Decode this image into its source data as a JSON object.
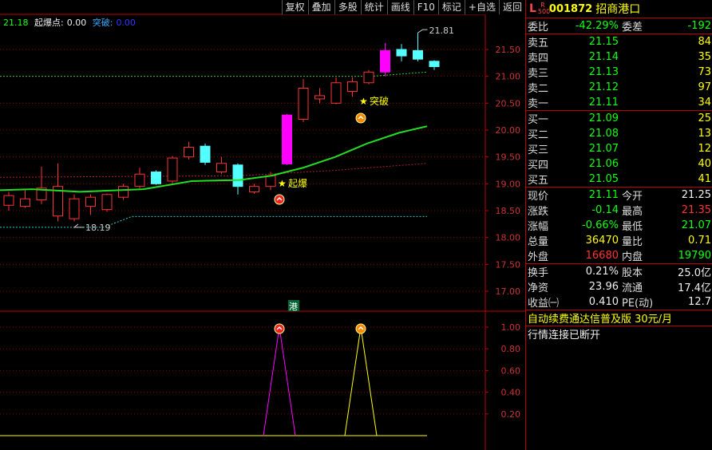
{
  "menu": [
    "复权",
    "叠加",
    "多股",
    "统计",
    "画线",
    "F10",
    "标记",
    "+自选",
    "返回"
  ],
  "indicator": {
    "price": "21.18",
    "qibao_label": "起爆点:",
    "qibao_value": "0.00",
    "tupo_label": "突破:",
    "tupo_value": "0.00"
  },
  "price_axis": [
    "21.50",
    "21.00",
    "20.50",
    "20.00",
    "19.50",
    "19.00",
    "18.50",
    "18.00",
    "17.50",
    "17.00"
  ],
  "sub_axis": [
    "1.00",
    "0.80",
    "0.60",
    "0.40",
    "0.20"
  ],
  "annotations": {
    "high": "21.81",
    "low": "18.19",
    "qibao": "起爆",
    "tupo": "突破",
    "gang": "港"
  },
  "candles": [
    {
      "o": 18.6,
      "c": 18.78,
      "h": 18.85,
      "l": 18.5
    },
    {
      "o": 18.58,
      "c": 18.72,
      "h": 18.88,
      "l": 18.55
    },
    {
      "o": 18.7,
      "c": 18.92,
      "h": 19.32,
      "l": 18.62
    },
    {
      "o": 18.4,
      "c": 18.95,
      "h": 19.38,
      "l": 18.3
    },
    {
      "o": 18.35,
      "c": 18.72,
      "h": 18.8,
      "l": 18.3
    },
    {
      "o": 18.58,
      "c": 18.75,
      "h": 18.8,
      "l": 18.42
    },
    {
      "o": 18.52,
      "c": 18.8,
      "h": 18.82,
      "l": 18.48
    },
    {
      "o": 18.75,
      "c": 18.95,
      "h": 19.0,
      "l": 18.7
    },
    {
      "o": 18.95,
      "c": 19.18,
      "h": 19.3,
      "l": 18.92
    },
    {
      "o": 19.22,
      "c": 19.0,
      "h": 19.25,
      "l": 18.98
    },
    {
      "o": 19.05,
      "c": 19.48,
      "h": 19.52,
      "l": 19.0
    },
    {
      "o": 19.5,
      "c": 19.68,
      "h": 19.78,
      "l": 19.45
    },
    {
      "o": 19.7,
      "c": 19.4,
      "h": 19.75,
      "l": 19.35
    },
    {
      "o": 19.22,
      "c": 19.38,
      "h": 19.5,
      "l": 19.18
    },
    {
      "o": 19.35,
      "c": 18.95,
      "h": 19.38,
      "l": 18.8
    },
    {
      "o": 18.85,
      "c": 18.95,
      "h": 19.0,
      "l": 18.82
    },
    {
      "o": 18.95,
      "c": 19.15,
      "h": 19.22,
      "l": 18.88
    },
    {
      "o": 19.37,
      "c": 20.28,
      "h": 20.3,
      "l": 19.35
    },
    {
      "o": 20.2,
      "c": 20.78,
      "h": 20.95,
      "l": 20.15
    },
    {
      "o": 20.58,
      "c": 20.64,
      "h": 20.78,
      "l": 20.5
    },
    {
      "o": 20.5,
      "c": 20.88,
      "h": 20.98,
      "l": 20.48
    },
    {
      "o": 20.72,
      "c": 20.9,
      "h": 20.98,
      "l": 20.62
    },
    {
      "o": 20.88,
      "c": 21.08,
      "h": 21.12,
      "l": 20.85
    },
    {
      "o": 21.08,
      "c": 21.48,
      "h": 21.62,
      "l": 21.0
    },
    {
      "o": 21.5,
      "c": 21.38,
      "h": 21.6,
      "l": 21.28
    },
    {
      "o": 21.48,
      "c": 21.32,
      "h": 21.81,
      "l": 21.28
    },
    {
      "o": 21.28,
      "c": 21.18,
      "h": 21.3,
      "l": 21.12
    }
  ],
  "quote": {
    "market": "L",
    "r500": "R 500",
    "code": "001872",
    "name": "招商港口",
    "weibi_label": "委比",
    "weibi": "-42.29%",
    "weicha_label": "委差",
    "weicha": "-192",
    "asks": [
      {
        "label": "卖五",
        "price": "21.15",
        "vol": "84"
      },
      {
        "label": "卖四",
        "price": "21.14",
        "vol": "35"
      },
      {
        "label": "卖三",
        "price": "21.13",
        "vol": "73"
      },
      {
        "label": "卖二",
        "price": "21.12",
        "vol": "97"
      },
      {
        "label": "卖一",
        "price": "21.11",
        "vol": "34"
      }
    ],
    "bids": [
      {
        "label": "买一",
        "price": "21.09",
        "vol": "25"
      },
      {
        "label": "买二",
        "price": "21.08",
        "vol": "13"
      },
      {
        "label": "买三",
        "price": "21.07",
        "vol": "12"
      },
      {
        "label": "买四",
        "price": "21.06",
        "vol": "40"
      },
      {
        "label": "买五",
        "price": "21.05",
        "vol": "41"
      }
    ],
    "stats1": [
      {
        "l1": "现价",
        "v1": "21.11",
        "c1": "grn",
        "l2": "今开",
        "v2": "21.25",
        "c2": "wht"
      },
      {
        "l1": "涨跌",
        "v1": "-0.14",
        "c1": "grn",
        "l2": "最高",
        "v2": "21.35",
        "c2": "red"
      },
      {
        "l1": "涨幅",
        "v1": "-0.66%",
        "c1": "grn",
        "l2": "最低",
        "v2": "21.07",
        "c2": "grn"
      },
      {
        "l1": "总量",
        "v1": "36470",
        "c1": "yel",
        "l2": "量比",
        "v2": "0.71",
        "c2": "yel"
      },
      {
        "l1": "外盘",
        "v1": "16680",
        "c1": "red",
        "l2": "内盘",
        "v2": "19790",
        "c2": "grn"
      }
    ],
    "stats2": [
      {
        "l1": "换手",
        "v1": "0.21%",
        "l2": "股本",
        "v2": "25.0亿"
      },
      {
        "l1": "净资",
        "v1": "23.96",
        "l2": "流通",
        "v2": "17.4亿"
      },
      {
        "l1": "收益㈠",
        "v1": "0.410",
        "l2": "PE(动)",
        "v2": "12.7"
      }
    ],
    "ad": "自动续费通达信普及版  30元/月",
    "status": "行情连接已断开"
  },
  "colors": {
    "up": "#ff3232",
    "down": "#54ffff",
    "magenta": "#ff00ff",
    "ma": "#22dd22",
    "grid": "#8b0000"
  }
}
